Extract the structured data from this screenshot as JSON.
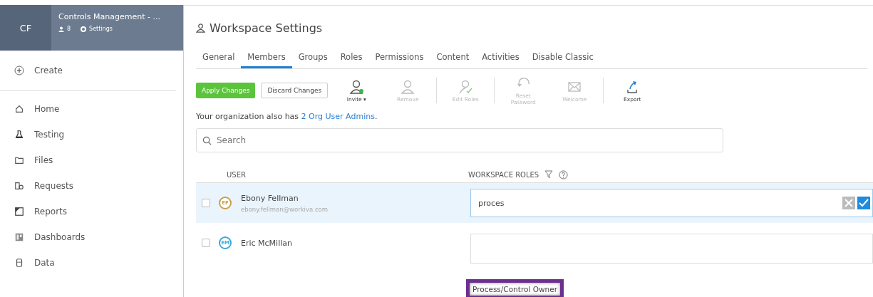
{
  "workspace": {
    "initials": "CF",
    "title": "Controls Management - ...",
    "member_count": "8",
    "settings_label": "Settings"
  },
  "sidebar": {
    "create": "Create",
    "items": [
      {
        "label": "Home"
      },
      {
        "label": "Testing"
      },
      {
        "label": "Files"
      },
      {
        "label": "Requests"
      },
      {
        "label": "Reports"
      },
      {
        "label": "Dashboards"
      },
      {
        "label": "Data"
      }
    ]
  },
  "page_title": "Workspace Settings",
  "tabs": [
    {
      "label": "General",
      "selected": false
    },
    {
      "label": "Members",
      "selected": true
    },
    {
      "label": "Groups",
      "selected": false
    },
    {
      "label": "Roles",
      "selected": false
    },
    {
      "label": "Permissions",
      "selected": false
    },
    {
      "label": "Content",
      "selected": false
    },
    {
      "label": "Activities",
      "selected": false
    },
    {
      "label": "Disable Classic",
      "selected": false
    }
  ],
  "buttons": {
    "apply": "Apply Changes",
    "discard": "Discard Changes"
  },
  "toolbar": [
    {
      "label": "Invite",
      "disabled": false,
      "caret": "▾"
    },
    {
      "label": "Remove",
      "disabled": true
    },
    {
      "label": "Edit Roles",
      "disabled": true
    },
    {
      "label": "Reset Password",
      "disabled": true
    },
    {
      "label": "Welcome",
      "disabled": true
    },
    {
      "label": "Export",
      "disabled": false
    }
  ],
  "notice": {
    "text": "Your organization also has ",
    "link": "2 Org User Admins",
    "end": "."
  },
  "search": {
    "placeholder": "Search"
  },
  "table": {
    "columns": [
      "USER",
      "WORKSPACE ROLES"
    ],
    "rows": [
      {
        "initials": "EF",
        "color": "#c8a04a",
        "name": "Ebony Fellman",
        "email": "ebony.fellman@workiva.com",
        "selected": true,
        "checked": false,
        "roles_value": "proces"
      },
      {
        "initials": "EM",
        "color": "#3aa8d8",
        "name": "Eric McMillan",
        "selected": false,
        "checked": false
      }
    ]
  },
  "suggestion": "Process/Control Owner"
}
